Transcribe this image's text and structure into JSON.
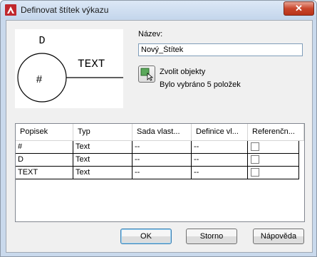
{
  "window": {
    "title": "Definovat štítek výkazu",
    "close_glyph": "✕"
  },
  "preview": {
    "label_top": "D",
    "label_center": "#",
    "label_text": "TEXT"
  },
  "name": {
    "label": "Název:",
    "value": "Nový_Štítek"
  },
  "select": {
    "label": "Zvolit objekty",
    "status": "Bylo vybráno 5 položek"
  },
  "table": {
    "headers": [
      "Popisek",
      "Typ",
      "Sada vlast...",
      "Definice vl...",
      "Referenčn..."
    ],
    "rows": [
      {
        "popisek": "#",
        "typ": "Text",
        "sada": "--",
        "definice": "--",
        "ref_checked": false
      },
      {
        "popisek": "D",
        "typ": "Text",
        "sada": "--",
        "definice": "--",
        "ref_checked": false
      },
      {
        "popisek": "TEXT",
        "typ": "Text",
        "sada": "--",
        "definice": "--",
        "ref_checked": false
      }
    ]
  },
  "buttons": {
    "ok": "OK",
    "cancel": "Storno",
    "help": "Nápověda"
  },
  "colors": {
    "titlebar": "#c4d6ec",
    "close": "#c9462c",
    "brand": "#c0282d"
  }
}
